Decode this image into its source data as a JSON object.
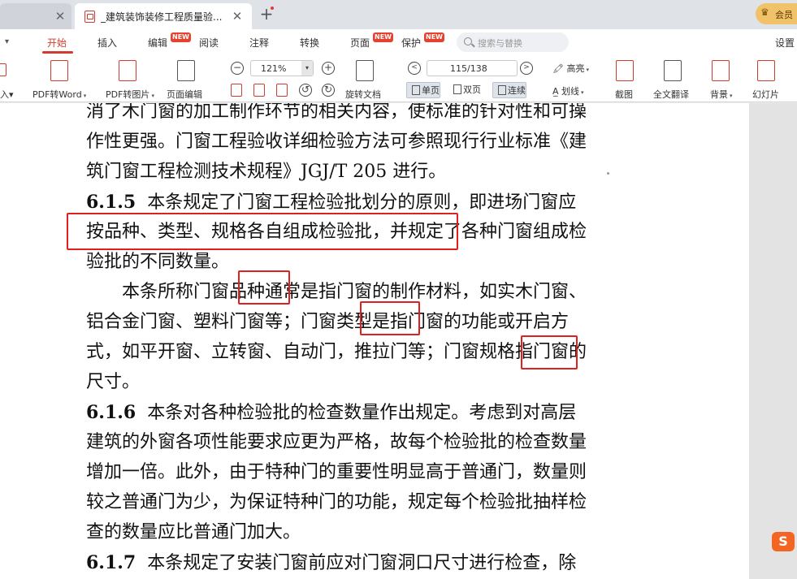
{
  "tabs": {
    "active_title": "_建筑装饰装修工程质量验...",
    "close_glyph": "✕",
    "new_tab_glyph": "+"
  },
  "account": {
    "vip_text": "会员",
    "crown": "♛"
  },
  "menu": {
    "toggle_glyph": "▾",
    "items": [
      {
        "label": "开始",
        "active": true
      },
      {
        "label": "插入"
      },
      {
        "label": "编辑",
        "badge": "NEW"
      },
      {
        "label": "阅读"
      },
      {
        "label": "注释"
      },
      {
        "label": "转换"
      },
      {
        "label": "页面",
        "badge": "NEW"
      },
      {
        "label": "保护",
        "badge": "NEW"
      },
      {
        "label": "设置"
      }
    ],
    "search_placeholder": "搜索与替换"
  },
  "toolbar": {
    "insert_partial": "入▾",
    "pdf_to_word": "PDF转Word",
    "pdf_to_image": "PDF转图片",
    "page_edit": "页面编辑",
    "zoom_value": "121%",
    "rotate_doc": "旋转文档",
    "page_indicator": "115/138",
    "view_single": "单页",
    "view_double": "双页",
    "view_continuous": "连续",
    "highlight": "高亮",
    "underline": "划线",
    "screenshot": "截图",
    "full_translate": "全文翻译",
    "background": "背景",
    "slideshow": "幻灯片",
    "dropdown_glyph": "▾"
  },
  "document": {
    "lines": [
      "消了木门窗的加工制作环节的相关内容，使标准的针对性和可操",
      "作性更强。门窗工程验收详细检验方法可参照现行行业标准《建",
      "筑门窗工程检测技术规程》JGJ/T 205 进行。",
      "本条规定了门窗工程检验批划分的原则，即进场门窗应",
      "按品种、类型、规格各自组成检验批，并规定了各种门窗组成检",
      "验批的不同数量。",
      "　　本条所称门窗品种通常是指门窗的制作材料，如实木门窗、",
      "铝合金门窗、塑料门窗等；门窗类型是指门窗的功能或开启方",
      "式，如平开窗、立转窗、自动门，推拉门等；门窗规格指门窗的",
      "尺寸。",
      "本条对各种检验批的检查数量作出规定。考虑到对高层",
      "建筑的外窗各项性能要求应更为严格，故每个检验批的检查数量",
      "增加一倍。此外，由于特种门的重要性明显高于普通门，数量则",
      "较之普通门为少，为保证特种门的功能，规定每个检验批抽样检",
      "查的数量应比普通门加大。",
      "本条规定了安装门窗前应对门窗洞口尺寸进行检查，除"
    ],
    "sections": {
      "s615": "6.1.5",
      "s616": "6.1.6",
      "s617": "6.1.7"
    }
  },
  "ime": {
    "glyph": "S"
  }
}
